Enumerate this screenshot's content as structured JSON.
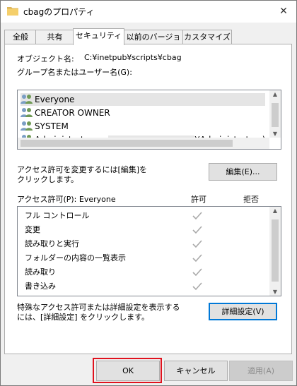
{
  "window": {
    "title": "cbagのプロパティ",
    "close_glyph": "✕"
  },
  "tabs": [
    {
      "label": "全般",
      "active": false
    },
    {
      "label": "共有",
      "active": false
    },
    {
      "label": "セキュリティ",
      "active": true
    },
    {
      "label": "以前のバージョン",
      "active": false
    },
    {
      "label": "カスタマイズ",
      "active": false
    }
  ],
  "object": {
    "label": "オブジェクト名:",
    "value": "C:¥inetpub¥scripts¥cbag"
  },
  "users_label": "グループ名またはユーザー名(G):",
  "users": [
    {
      "name": "Everyone",
      "selected": true
    },
    {
      "name": "CREATOR OWNER",
      "selected": false
    },
    {
      "name": "SYSTEM",
      "selected": false
    },
    {
      "name": "Administrators",
      "suffix": "¥Administrators)",
      "selected": false
    }
  ],
  "change_note": "アクセス許可を変更するには[編集]を\nクリックします。",
  "edit_button": "編集(E)...",
  "perm_header": {
    "label": "アクセス許可(P): Everyone",
    "allow": "許可",
    "deny": "拒否"
  },
  "permissions": [
    {
      "name": "フル コントロール",
      "allow": true,
      "deny": false
    },
    {
      "name": "変更",
      "allow": true,
      "deny": false
    },
    {
      "name": "読み取りと実行",
      "allow": true,
      "deny": false
    },
    {
      "name": "フォルダーの内容の一覧表示",
      "allow": true,
      "deny": false
    },
    {
      "name": "読み取り",
      "allow": true,
      "deny": false
    },
    {
      "name": "書き込み",
      "allow": true,
      "deny": false
    }
  ],
  "advanced_note": "特殊なアクセス許可または詳細設定を表示する\nには、[詳細設定] をクリックします。",
  "advanced_button": "詳細設定(V)",
  "footer": {
    "ok": "OK",
    "cancel": "キャンセル",
    "apply": "適用(A)"
  },
  "colors": {
    "selection": "#e5e5e5",
    "highlight_box": "#e0121e",
    "focus_border": "#0078d7",
    "check_gray": "#a9a9a9"
  }
}
